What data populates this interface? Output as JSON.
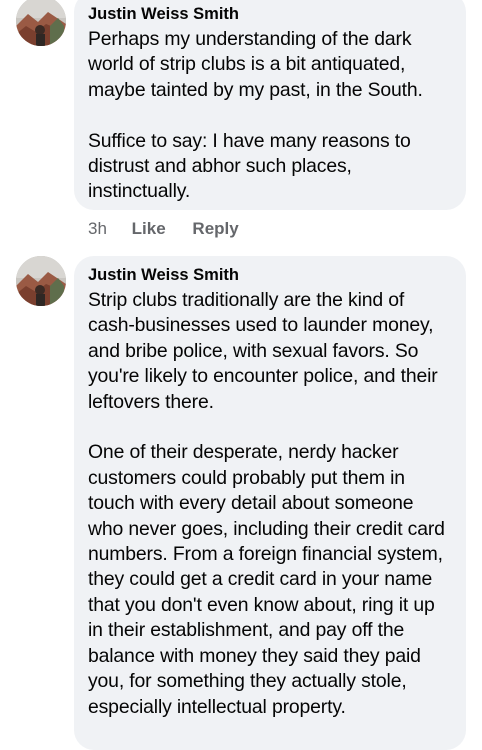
{
  "comments": [
    {
      "author": "Justin Weiss Smith",
      "text": "Perhaps my understanding of the dark world of strip clubs is a bit antiquated, maybe tainted by my past, in the South.\n\nSuffice to say: I have many reasons to distrust and abhor such places, instinctually.",
      "time": "3h",
      "like_label": "Like",
      "reply_label": "Reply"
    },
    {
      "author": "Justin Weiss Smith",
      "text": "Strip clubs traditionally are the kind of cash-businesses used to launder money, and bribe police, with sexual favors. So you're likely to encounter police, and their leftovers there.\n\nOne of their desperate, nerdy hacker customers could probably put them in touch with every detail about someone who never goes, including their credit card numbers. From a foreign financial system, they could get a credit card in your name that you don't even know about, ring it up in their establishment, and pay off the balance with money they said they paid you, for something they actually stole, especially intellectual property."
    }
  ],
  "avatar_icon": "profile-photo-icon"
}
